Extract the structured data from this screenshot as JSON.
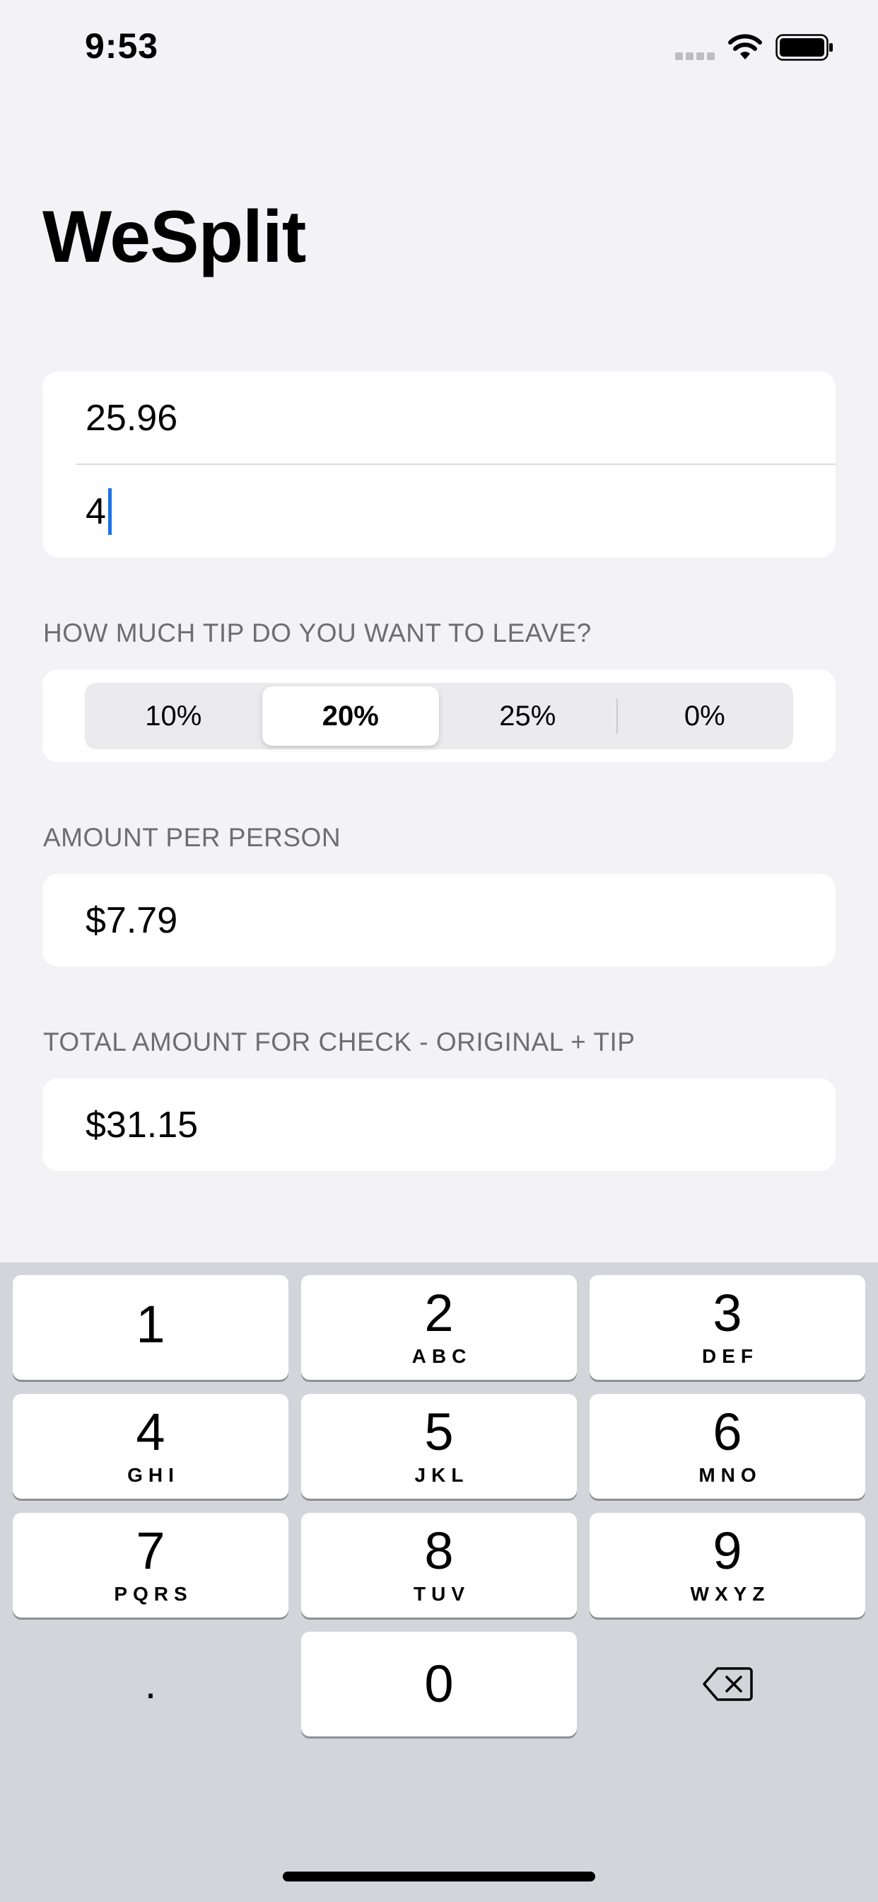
{
  "status_bar": {
    "time": "9:53"
  },
  "title": "WeSplit",
  "form": {
    "check_amount": "25.96",
    "number_of_people": "4"
  },
  "tip_section": {
    "header": "HOW MUCH TIP DO YOU WANT TO LEAVE?",
    "options": [
      "10%",
      "20%",
      "25%",
      "0%"
    ],
    "selected": "20%"
  },
  "per_person_section": {
    "header": "AMOUNT PER PERSON",
    "value": "$7.79"
  },
  "total_section": {
    "header": "TOTAL AMOUNT FOR CHECK - ORIGINAL + TIP",
    "value": "$31.15"
  },
  "keyboard": {
    "keys": [
      {
        "digit": "1",
        "letters": ""
      },
      {
        "digit": "2",
        "letters": "ABC"
      },
      {
        "digit": "3",
        "letters": "DEF"
      },
      {
        "digit": "4",
        "letters": "GHI"
      },
      {
        "digit": "5",
        "letters": "JKL"
      },
      {
        "digit": "6",
        "letters": "MNO"
      },
      {
        "digit": "7",
        "letters": "PQRS"
      },
      {
        "digit": "8",
        "letters": "TUV"
      },
      {
        "digit": "9",
        "letters": "WXYZ"
      }
    ],
    "decimal": ".",
    "zero": "0",
    "delete_icon": "delete-backspace-icon"
  },
  "colors": {
    "background": "#f2f2f7",
    "keyboard_background": "#d4d5da",
    "caret": "#1a73e8",
    "section_header": "#6d6d72"
  }
}
